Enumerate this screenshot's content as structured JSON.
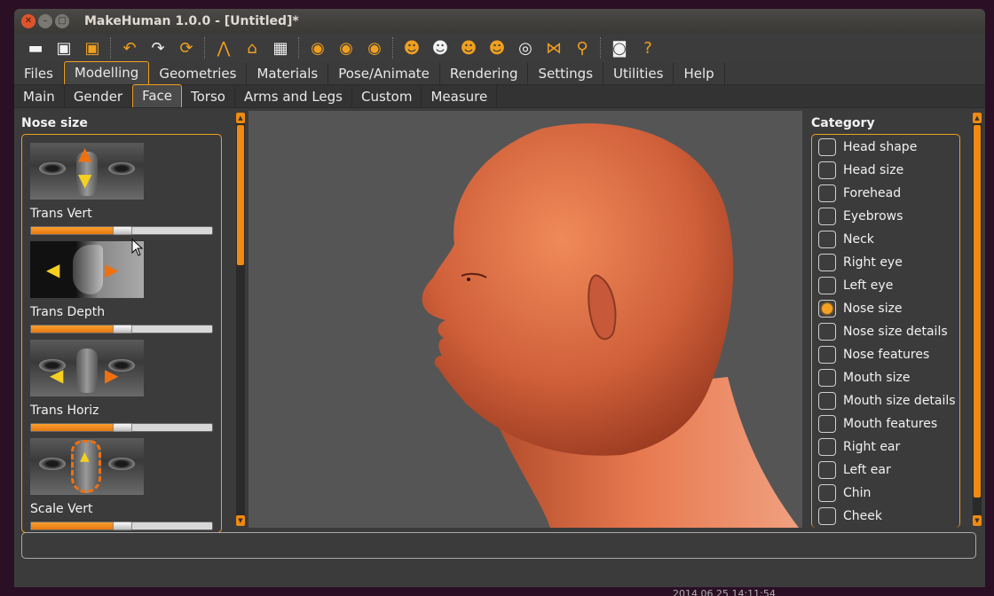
{
  "window": {
    "title": "MakeHuman 1.0.0 - [Untitled]*"
  },
  "toolbar": {
    "groups": [
      [
        "folder-open-icon",
        "save-icon",
        "export-icon"
      ],
      [
        "undo-icon",
        "redo-icon",
        "reset-icon"
      ],
      [
        "wireframe-icon",
        "smooth-icon",
        "background-icon"
      ],
      [
        "front-view-icon",
        "back-view-icon",
        "side-view-icon"
      ],
      [
        "left-view-icon",
        "right-view-icon",
        "top-view-icon",
        "bottom-view-icon",
        "reset-camera-icon",
        "symmetry-icon",
        "pose-icon"
      ],
      [
        "screenshot-icon",
        "help-icon"
      ]
    ]
  },
  "main_tabs": [
    "Files",
    "Modelling",
    "Geometries",
    "Materials",
    "Pose/Animate",
    "Rendering",
    "Settings",
    "Utilities",
    "Help"
  ],
  "main_tab_active": "Modelling",
  "sub_tabs": [
    "Main",
    "Gender",
    "Face",
    "Torso",
    "Arms and Legs",
    "Custom",
    "Measure"
  ],
  "sub_tab_active": "Face",
  "left_panel": {
    "title": "Nose size",
    "sliders": [
      {
        "label": "Trans Vert",
        "value": 0.5
      },
      {
        "label": "Trans Depth",
        "value": 0.5
      },
      {
        "label": "Trans Horiz",
        "value": 0.5
      },
      {
        "label": "Scale Vert",
        "value": 0.5
      }
    ]
  },
  "category": {
    "title": "Category",
    "items": [
      "Head shape",
      "Head size",
      "Forehead",
      "Eyebrows",
      "Neck",
      "Right eye",
      "Left eye",
      "Nose size",
      "Nose size details",
      "Nose features",
      "Mouth size",
      "Mouth size details",
      "Mouth features",
      "Right ear",
      "Left ear",
      "Chin",
      "Cheek"
    ],
    "selected": "Nose size"
  },
  "status": {
    "text": ""
  },
  "timestamp": "2014 06 25 14:11:54",
  "colors": {
    "accent": "#f0a020",
    "skin": "#e07a4e",
    "viewport_bg": "#555555"
  }
}
